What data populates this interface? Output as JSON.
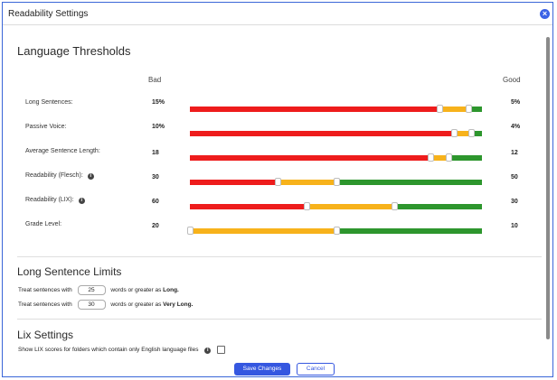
{
  "dialog": {
    "title": "Readability Settings",
    "close_icon": "close-icon"
  },
  "thresholds": {
    "heading": "Language Thresholds",
    "bad_label": "Bad",
    "good_label": "Good",
    "rows": [
      {
        "label": "Long Sentences:",
        "bad": "15%",
        "good": "5%",
        "info": false,
        "red_end": 0.854,
        "yellow_end": 0.954
      },
      {
        "label": "Passive Voice:",
        "bad": "10%",
        "good": "4%",
        "info": false,
        "red_end": 0.904,
        "yellow_end": 0.964
      },
      {
        "label": "Average Sentence Length:",
        "bad": "18",
        "good": "12",
        "info": false,
        "red_end": 0.824,
        "yellow_end": 0.884
      },
      {
        "label": "Readability (Flesch):",
        "bad": "30",
        "good": "50",
        "info": true,
        "red_end": 0.3,
        "yellow_end": 0.5
      },
      {
        "label": "Readability (LIX):",
        "bad": "60",
        "good": "30",
        "info": true,
        "red_end": 0.4,
        "yellow_end": 0.7
      },
      {
        "label": "Grade Level:",
        "bad": "20",
        "good": "10",
        "info": false,
        "red_end": 0.0,
        "yellow_end": 0.5
      }
    ]
  },
  "long_sentence_limits": {
    "heading": "Long Sentence Limits",
    "line1_prefix": "Treat sentences with",
    "line1_value": "25",
    "line1_suffix": "words or greater as",
    "line1_label": "Long.",
    "line2_prefix": "Treat sentences with",
    "line2_value": "30",
    "line2_suffix": "words or greater as",
    "line2_label": "Very Long."
  },
  "lix_settings": {
    "heading": "Lix Settings",
    "checkbox_label": "Show LIX scores for folders which contain only English language files",
    "checked": false
  },
  "actions": {
    "save": "Save Changes",
    "cancel": "Cancel"
  },
  "colors": {
    "red": "#ee1c1c",
    "yellow": "#f7b21b",
    "green": "#2d962d",
    "accent": "#3557e0"
  }
}
